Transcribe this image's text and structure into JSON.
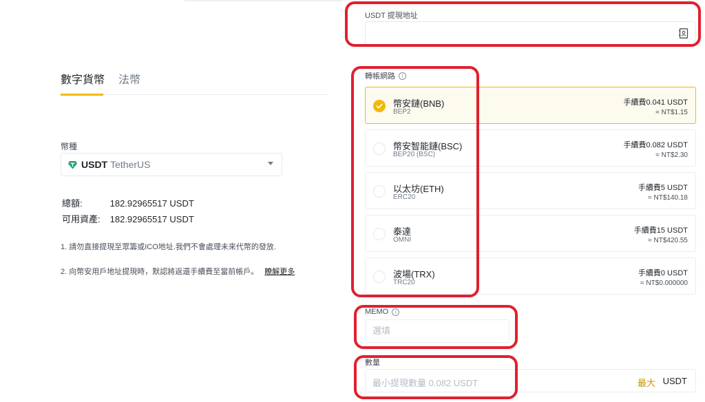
{
  "tabs": {
    "crypto": "數字貨幣",
    "fiat": "法幣"
  },
  "coin": {
    "label": "幣種",
    "symbol": "USDT",
    "fullname": "TetherUS",
    "icon": "tether-diamond-icon",
    "color": "#26a17b"
  },
  "balance": {
    "total_label": "總額:",
    "total_value": "182.92965517 USDT",
    "avail_label": "可用資產:",
    "avail_value": "182.92965517 USDT"
  },
  "notes": {
    "note1": "1. 請勿直接提現至眾籌或ICO地址.我們不會處理未來代幣的發放.",
    "note2": "2. 向幣安用戶地址提現時，默認將返還手續費至當前帳戶。",
    "learn_more": "瞭解更多"
  },
  "address": {
    "label": "USDT 提現地址",
    "icon": "address-book-icon"
  },
  "network": {
    "label": "轉帳網路",
    "options": [
      {
        "name": "幣安鏈(BNB)",
        "sub": "BEP2",
        "fee": "手續費0.041 USDT",
        "approx": "≈ NT$1.15",
        "selected": true
      },
      {
        "name": "幣安智能鏈(BSC)",
        "sub": "BEP20 (BSC)",
        "fee": "手續費0.082 USDT",
        "approx": "≈ NT$2.30",
        "selected": false
      },
      {
        "name": "以太坊(ETH)",
        "sub": "ERC20",
        "fee": "手續費5 USDT",
        "approx": "≈ NT$140.18",
        "selected": false
      },
      {
        "name": "泰達",
        "sub": "OMNI",
        "fee": "手續費15 USDT",
        "approx": "≈ NT$420.55",
        "selected": false
      },
      {
        "name": "波場(TRX)",
        "sub": "TRC20",
        "fee": "手續費0 USDT",
        "approx": "≈ NT$0.000000",
        "selected": false
      }
    ]
  },
  "memo": {
    "label": "MEMO",
    "placeholder": "選填"
  },
  "amount": {
    "label": "數量",
    "placeholder": "最小提現數量 0.082 USDT",
    "max": "最大",
    "unit": "USDT"
  },
  "colors": {
    "accent": "#f0b90b",
    "highlight": "#e0202e",
    "link": "#c99400"
  }
}
